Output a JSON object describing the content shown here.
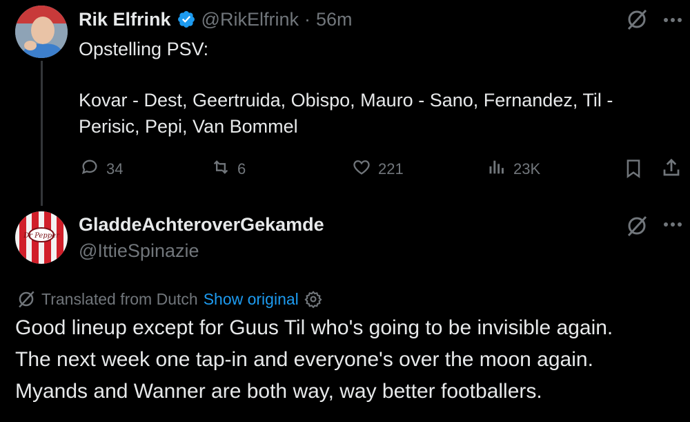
{
  "tweet": {
    "author_name": "Rik Elfrink",
    "handle": "@RikElfrink",
    "separator": "·",
    "time": "56m",
    "text_line1": "Opstelling PSV:",
    "text_line2": "Kovar - Dest, Geertruida, Obispo, Mauro - Sano, Fernandez, Til -",
    "text_line3": "Perisic, Pepi, Van Bommel",
    "replies": "34",
    "retweets": "6",
    "likes": "221",
    "views": "23K"
  },
  "reply": {
    "author_name": "GladdeAchteroverGekamde",
    "handle": "@IttieSpinazie",
    "translated_label": "Translated from Dutch",
    "show_original": "Show original",
    "text_line1": "Good lineup except for Guus Til who's going to be invisible again.",
    "text_line2": "The next week one tap-in and everyone's over the moon again.",
    "text_line3": "Myands and Wanner are both way, way better footballers."
  },
  "colors": {
    "background": "#000000",
    "text": "#e7e9ea",
    "muted": "#71767b",
    "link": "#1d9bf0",
    "verified": "#1d9bf0"
  },
  "icons": [
    "verified-badge-icon",
    "grok-icon",
    "more-icon",
    "reply-icon",
    "retweet-icon",
    "like-icon",
    "views-icon",
    "bookmark-icon",
    "share-icon",
    "translate-icon",
    "gear-icon"
  ]
}
